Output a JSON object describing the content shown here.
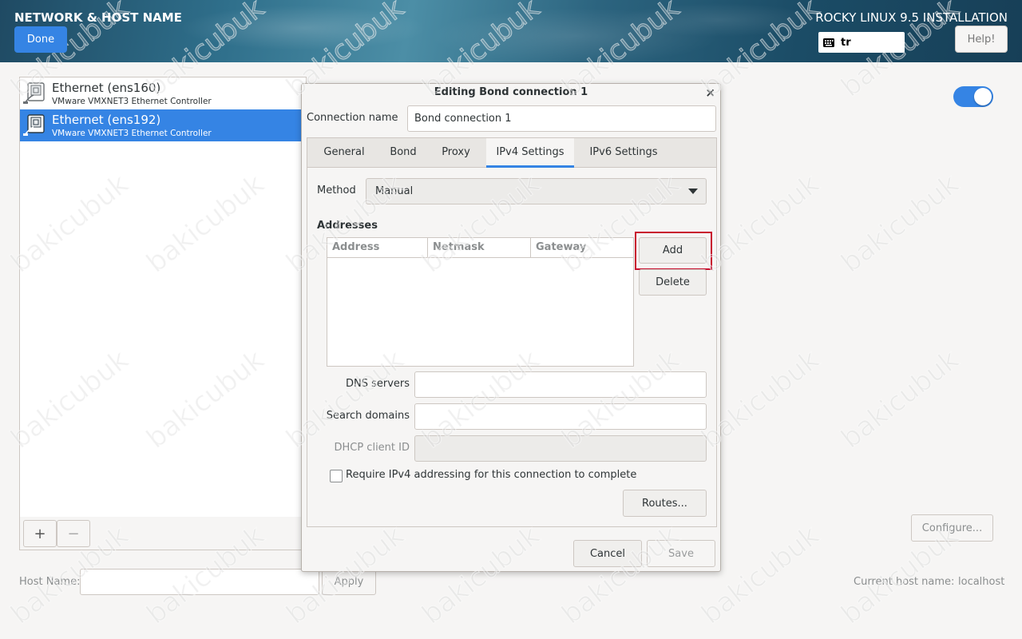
{
  "header": {
    "title": "NETWORK & HOST NAME",
    "done_label": "Done",
    "install_title": "ROCKY LINUX 9.5 INSTALLATION",
    "keyboard_layout": "tr",
    "help_label": "Help!"
  },
  "devices": [
    {
      "name": "Ethernet (ens160)",
      "description": "VMware VMXNET3 Ethernet Controller",
      "selected": false
    },
    {
      "name": "Ethernet (ens192)",
      "description": "VMware VMXNET3 Ethernet Controller",
      "selected": true
    }
  ],
  "list_toolbar": {
    "add_label": "+",
    "remove_label": "−"
  },
  "host": {
    "label": "Host Name:",
    "value": "",
    "apply_label": "Apply",
    "current_label": "Current host name:",
    "current_value": "localhost"
  },
  "right_panel": {
    "toggle_on": true,
    "configure_label": "Configure..."
  },
  "dialog": {
    "title": "Editing Bond connection 1",
    "close_glyph": "×",
    "connection_name_label": "Connection name",
    "connection_name_value": "Bond connection 1",
    "tabs": [
      "General",
      "Bond",
      "Proxy",
      "IPv4 Settings",
      "IPv6 Settings"
    ],
    "active_tab": "IPv4 Settings",
    "method_label": "Method",
    "method_value": "Manual",
    "addresses_title": "Addresses",
    "address_columns": [
      "Address",
      "Netmask",
      "Gateway"
    ],
    "address_rows": [],
    "add_label": "Add",
    "delete_label": "Delete",
    "dns_label": "DNS servers",
    "dns_value": "",
    "search_label": "Search domains",
    "search_value": "",
    "dhcp_label": "DHCP client ID",
    "dhcp_value": "",
    "require_label": "Require IPv4 addressing for this connection to complete",
    "require_checked": false,
    "routes_label": "Routes...",
    "cancel_label": "Cancel",
    "save_label": "Save"
  },
  "watermark_text": "bakicubuk",
  "colors": {
    "accent": "#3584e4",
    "highlight": "#c8102e"
  }
}
